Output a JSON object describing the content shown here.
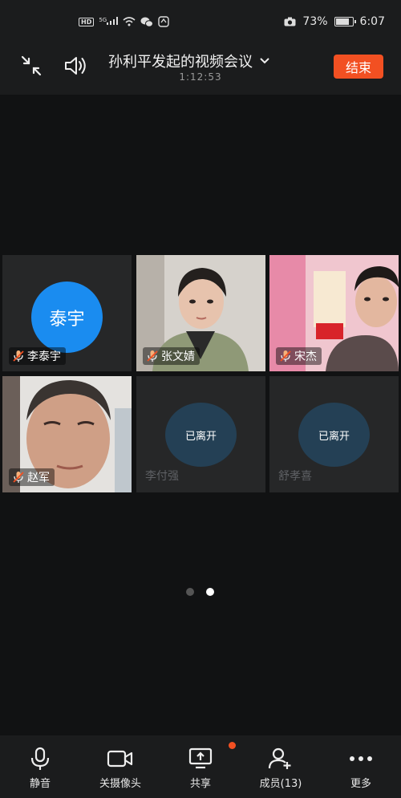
{
  "status_bar": {
    "hd_label": "HD",
    "network": "5G",
    "battery": "73%",
    "battery_level": 0.73,
    "time": "6:07"
  },
  "header": {
    "title": "孙利平发起的视频会议",
    "timer": "1:12:53",
    "end_label": "结束"
  },
  "participants": [
    {
      "name": "李泰宇",
      "avatar_text": "泰宇",
      "muted": true
    },
    {
      "name": "张文婧",
      "muted": true
    },
    {
      "name": "宋杰",
      "muted": true
    },
    {
      "name": "赵军",
      "muted": true
    },
    {
      "name": "李付强",
      "status": "已离开"
    },
    {
      "name": "舒孝喜",
      "status": "已离开"
    }
  ],
  "pagination": {
    "pages": 2,
    "current": 2
  },
  "toolbar": {
    "items": [
      {
        "label": "静音",
        "icon": "microphone-icon"
      },
      {
        "label": "关摄像头",
        "icon": "camera-icon"
      },
      {
        "label": "共享",
        "icon": "share-screen-icon"
      },
      {
        "label": "成员(13)",
        "icon": "add-member-icon"
      },
      {
        "label": "更多",
        "icon": "more-icon"
      }
    ]
  },
  "colors": {
    "accent": "#f25022",
    "avatar_blue": "#1a8cf0",
    "left_avatar": "#244055",
    "background": "#111213"
  }
}
